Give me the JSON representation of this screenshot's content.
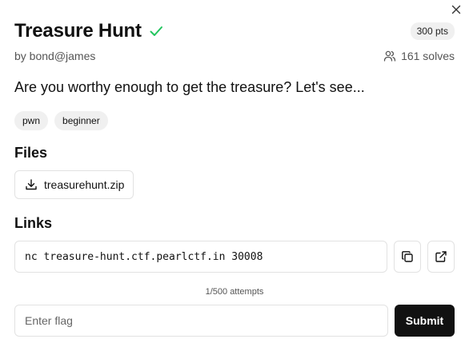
{
  "challenge": {
    "title": "Treasure Hunt",
    "solved_icon": "check-icon",
    "points": "300 pts",
    "author": "by bond@james",
    "solves": "161 solves",
    "description": "Are you worthy enough to get the treasure? Let's see...",
    "tags": [
      "pwn",
      "beginner"
    ]
  },
  "files": {
    "heading": "Files",
    "items": [
      {
        "name": "treasurehunt.zip",
        "icon": "download-icon"
      }
    ]
  },
  "links": {
    "heading": "Links",
    "items": [
      {
        "value": "nc treasure-hunt.ctf.pearlctf.in 30008",
        "copy_icon": "copy-icon",
        "open_icon": "external-link-icon"
      }
    ]
  },
  "submission": {
    "attempts": "1/500 attempts",
    "placeholder": "Enter flag",
    "value": "",
    "submit_label": "Submit"
  },
  "colors": {
    "solved": "#22c55e",
    "primary_button": "#111111",
    "badge_bg": "#f0f0f0",
    "border": "#e2e2e2"
  },
  "icons": {
    "close": "close-icon",
    "solves": "users-icon"
  }
}
